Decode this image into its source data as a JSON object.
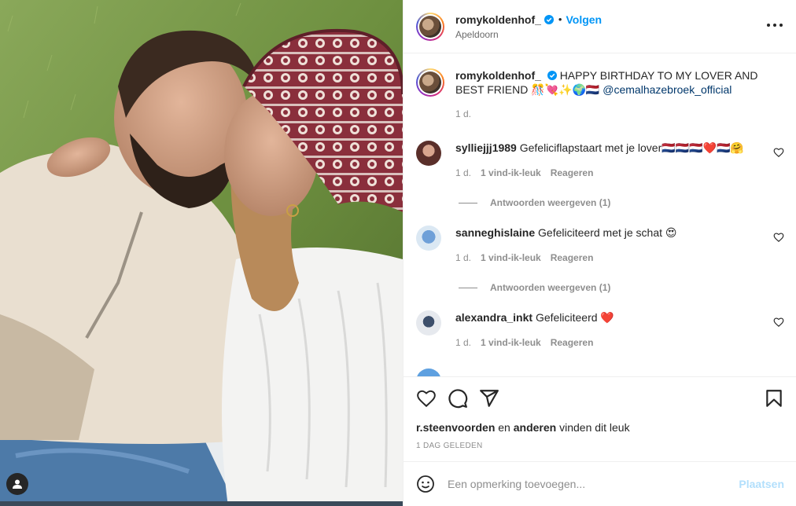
{
  "post": {
    "username": "romykoldenhof_",
    "follow_label": "Volgen",
    "dot": "•",
    "location": "Apeldoorn",
    "caption_text": "HAPPY BIRTHDAY TO MY LOVER AND BEST FRIEND 🎊💘✨🌍🇳🇱",
    "caption_mention": "@cemalhazebroek_official",
    "caption_time": "1 d."
  },
  "comments": [
    {
      "username": "sylliejjj1989",
      "text": "Gefeliciflapstaart met je lover🇳🇱🇳🇱🇳🇱❤️🇳🇱🤗",
      "time": "1 d.",
      "likes": "1 vind-ik-leuk",
      "reply": "Reageren",
      "view_replies": "Antwoorden weergeven (1)"
    },
    {
      "username": "sanneghislaine",
      "text": "Gefeliciteerd met je schat 😍",
      "time": "1 d.",
      "likes": "1 vind-ik-leuk",
      "reply": "Reageren",
      "view_replies": "Antwoorden weergeven (1)"
    },
    {
      "username": "alexandra_inkt",
      "text": "Gefeliciteerd ❤️",
      "time": "1 d.",
      "likes": "1 vind-ik-leuk",
      "reply": "Reageren"
    }
  ],
  "actions": {
    "liked_by_user": "r.steenvoorden",
    "liked_by_joiner": "en",
    "liked_by_others": "anderen",
    "liked_by_suffix": "vinden dit leuk",
    "timestamp": "1 DAG GELEDEN"
  },
  "add_comment": {
    "placeholder": "Een opmerking toevoegen...",
    "post_label": "Plaatsen"
  },
  "colors": {
    "accent": "#0095f6",
    "mention": "#00376b",
    "muted": "#8e8e8e",
    "post_disabled": "#b2dffc"
  }
}
